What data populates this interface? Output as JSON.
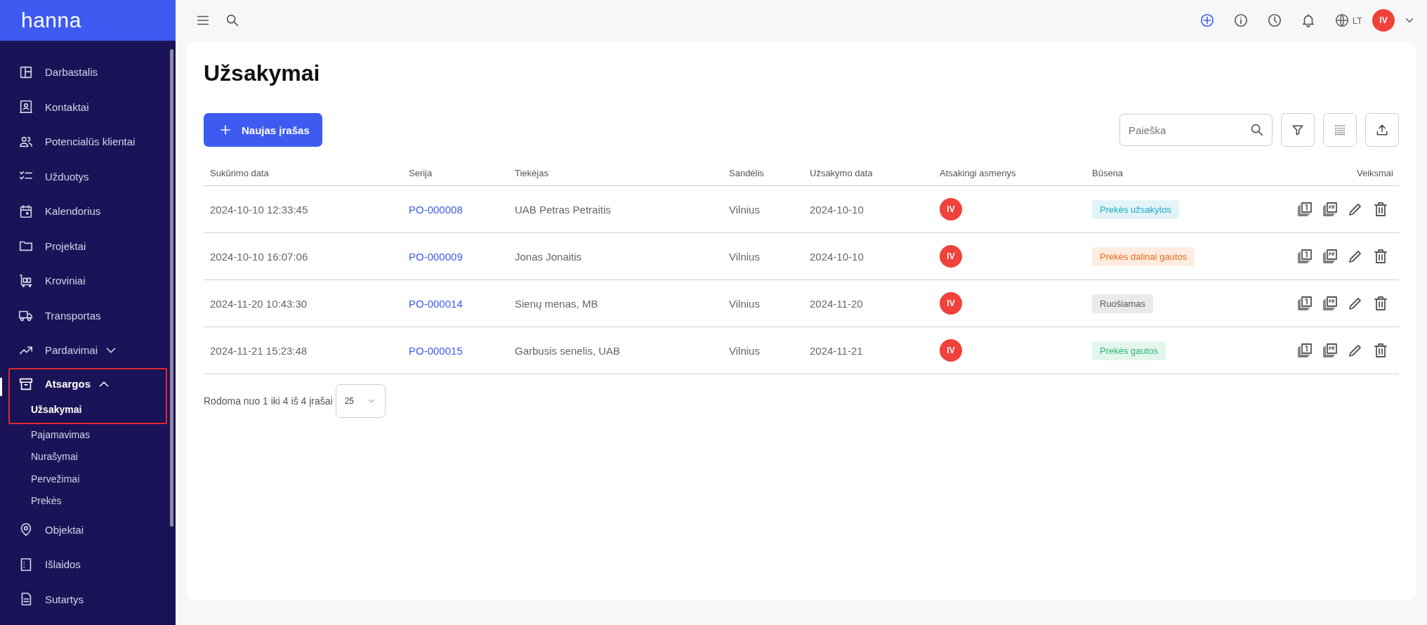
{
  "logo": "hanna",
  "sidebar": {
    "items": [
      {
        "label": "Darbastalis",
        "selected": false
      },
      {
        "label": "Kontaktai",
        "selected": false
      },
      {
        "label": "Potencialūs klientai",
        "selected": false
      },
      {
        "label": "Užduotys",
        "selected": false
      },
      {
        "label": "Kalendorius",
        "selected": false
      },
      {
        "label": "Projektai",
        "selected": false
      },
      {
        "label": "Kroviniai",
        "selected": false
      },
      {
        "label": "Transportas",
        "selected": false
      },
      {
        "label": "Pardavimai",
        "selected": false,
        "expanded": false
      },
      {
        "label": "Atsargos",
        "selected": true,
        "expanded": true,
        "children": [
          {
            "label": "Užsakymai",
            "selected": true
          },
          {
            "label": "Pajamavimas",
            "selected": false
          },
          {
            "label": "Nurašymai",
            "selected": false
          },
          {
            "label": "Pervežimai",
            "selected": false
          },
          {
            "label": "Prekės",
            "selected": false
          }
        ]
      },
      {
        "label": "Objektai",
        "selected": false
      },
      {
        "label": "Išlaidos",
        "selected": false
      },
      {
        "label": "Sutartys",
        "selected": false
      }
    ]
  },
  "topbar": {
    "language": "LT",
    "user_initials": "IV"
  },
  "page": {
    "title": "Užsakymai",
    "new_button": "Naujas įrašas",
    "search": {
      "placeholder": "Paieška"
    }
  },
  "table": {
    "columns": [
      "Sukūrimo data",
      "Serija",
      "Tiekėjas",
      "Sandėlis",
      "Užsakymo data",
      "Atsakingi asmenys",
      "Būsena",
      "Veiksmai"
    ],
    "rows": [
      {
        "created": "2024-10-10 12:33:45",
        "series": "PO-000008",
        "supplier": "UAB Petras Petraitis",
        "warehouse": "Vilnius",
        "order_date": "2024-10-10",
        "responsible": "IV",
        "status": "Prekės užsakytos",
        "color": "#1fa8c9"
      },
      {
        "created": "2024-10-10 16:07:06",
        "series": "PO-000009",
        "supplier": "Jonas Jonaitis",
        "warehouse": "Vilnius",
        "order_date": "2024-10-10",
        "responsible": "IV",
        "status": "Prekės dalinai gautos",
        "color": "#ef6c1a"
      },
      {
        "created": "2024-11-20 10:43:30",
        "series": "PO-000014",
        "supplier": "Sienų menas, MB",
        "warehouse": "Vilnius",
        "order_date": "2024-11-20",
        "responsible": "IV",
        "status": "Ruošiamas",
        "color": "#555a60"
      },
      {
        "created": "2024-11-21 15:23:48",
        "series": "PO-000015",
        "supplier": "Garbusis senelis, UAB",
        "warehouse": "Vilnius",
        "order_date": "2024-11-21",
        "responsible": "IV",
        "status": "Prekės gautos",
        "color": "#2bb673"
      }
    ]
  },
  "pagination": {
    "summary": "Rodoma nuo 1 iki 4 iš 4 įrašai",
    "page_size": "25"
  }
}
